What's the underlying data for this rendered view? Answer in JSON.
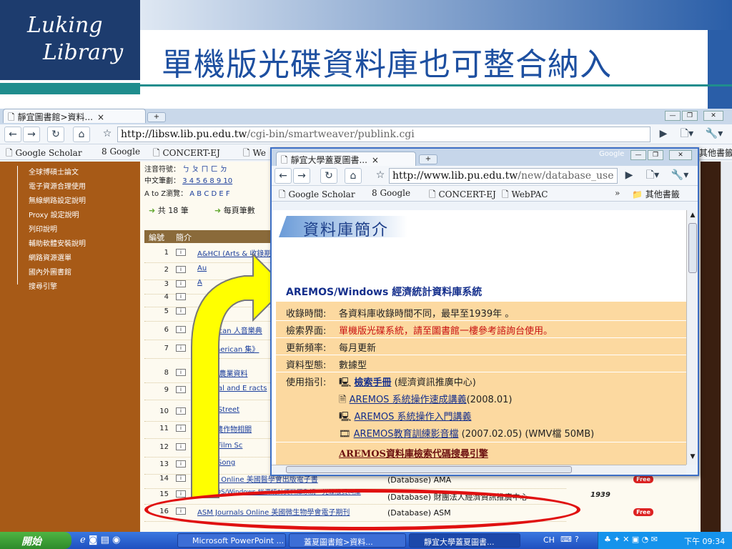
{
  "slide": {
    "title": "單機版光碟資料庫也可整合納入",
    "logo_line1": "Luking",
    "logo_line2": "Library"
  },
  "back_browser": {
    "tab_label": "靜宜圖書館>資料...",
    "url_host": "http://libsw.lib.pu.edu.tw",
    "url_path": "/cgi-bin/smartweaver/publink.cgi",
    "bookmarks": [
      "Google Scholar",
      "Google",
      "CONCERT-EJ",
      "We"
    ],
    "bookmark_other": "其他書籤",
    "sidebar_items": [
      "全球博碩士論文",
      "電子資源合理使用",
      "無線網路設定說明",
      "Proxy 設定說明",
      "列印說明",
      "輔助軟體安裝說明",
      "網路資源選單",
      "國內外圖書館",
      "搜尋引擎"
    ],
    "filters": {
      "zhuyin_label": "注音符號：",
      "zhuyin": "ㄅ ㄆ ㄇ ㄈ ㄉ",
      "stroke_label": "中文筆劃：",
      "strokes": "3 4 5 6 8 9 10",
      "atoz_label": "A to Z瀏覽：",
      "atoz": "A B C D E F",
      "count": "共 18 筆",
      "per_page": "每頁筆數"
    },
    "table_headers": {
      "id": "編號",
      "intro": "簡介"
    },
    "rows": [
      {
        "num": "1",
        "name": "A&HCI (Arts & 收錄期刊"
      },
      {
        "num": "2",
        "name": "Au"
      },
      {
        "num": "3",
        "name": "A"
      },
      {
        "num": "4",
        "name": ""
      },
      {
        "num": "5",
        "name": ""
      },
      {
        "num": "6",
        "name": "American 人音樂典"
      },
      {
        "num": "7",
        "name": "an American 集》"
      },
      {
        "num": "8",
        "name": "ICOLA農業資料"
      },
      {
        "num": "9",
        "name": "cultural and E racts"
      },
      {
        "num": "10",
        "name": "ueler Street"
      },
      {
        "num": "11",
        "name": "o非洲農作物相關"
      },
      {
        "num": "12",
        "name": "rican Film Sc"
      },
      {
        "num": "13",
        "name": "rican Song"
      },
      {
        "num": "14",
        "name": "Books Online 美國醫學會出版電子書",
        "source": "(Database) AMA",
        "free": "Free"
      },
      {
        "num": "15",
        "name": "AREMOS/Windows 經濟統計資料庫系統－光碟版資料庫",
        "source": "(Database) 財團法人經濟資訊推廣中心",
        "year": "1939"
      },
      {
        "num": "16",
        "name": "ASM Journals Online 美國微生物學會電子期刊",
        "source": "(Database) ASM",
        "free": "Free"
      }
    ]
  },
  "front_browser": {
    "tab_label": "靜宜大學蓋夏圖書...",
    "google_label": "Google",
    "url_host": "http://www.lib.pu.edu.tw",
    "url_path": "/new/database_use",
    "bookmarks": [
      "Google Scholar",
      "Google",
      "CONCERT-EJ",
      "WebPAC"
    ],
    "bookmark_other": "其他書籤",
    "header": "資料庫簡介",
    "db_title": "AREMOS/Windows 經濟統計資料庫系統",
    "fields": [
      {
        "label": "收錄時間:",
        "value": "各資料庫收錄時間不同，最早至1939年  。"
      },
      {
        "label": "檢索界面:",
        "value": "單機版光碟系統，請至圖書館一樓參考諮詢台使用。"
      },
      {
        "label": "更新頻率:",
        "value": "每月更新"
      },
      {
        "label": "資料型態:",
        "value": "數據型"
      },
      {
        "label": "使用指引:",
        "value": ""
      }
    ],
    "guides": [
      {
        "link": "檢索手冊",
        "suffix": " (經濟資訊推廣中心)"
      },
      {
        "link": "AREMOS 系統操作速成講義",
        "suffix": "(2008.01)"
      },
      {
        "link": "AREMOS 系統操作入門講義",
        "suffix": ""
      },
      {
        "link": "AREMOS教育訓練影音檔",
        "suffix": " (2007.02.05) (WMV檔 50MB)"
      }
    ],
    "bottom_heading": "AREMOS資料庫檢索代碼搜尋引擎"
  },
  "taskbar": {
    "start": "開始",
    "tasks": [
      "Microsoft PowerPoint ...",
      "蓋夏圖書館>資料...",
      "靜宜大學蓋夏圖書..."
    ],
    "lang": "CH",
    "clock": "下午 09:34"
  },
  "colors": {
    "sidebar": "#a75a17",
    "table_bg": "#fcd9a0",
    "arrow": "#ffff00",
    "ellipse": "#e01010",
    "title_blue": "#1d4fa0"
  }
}
